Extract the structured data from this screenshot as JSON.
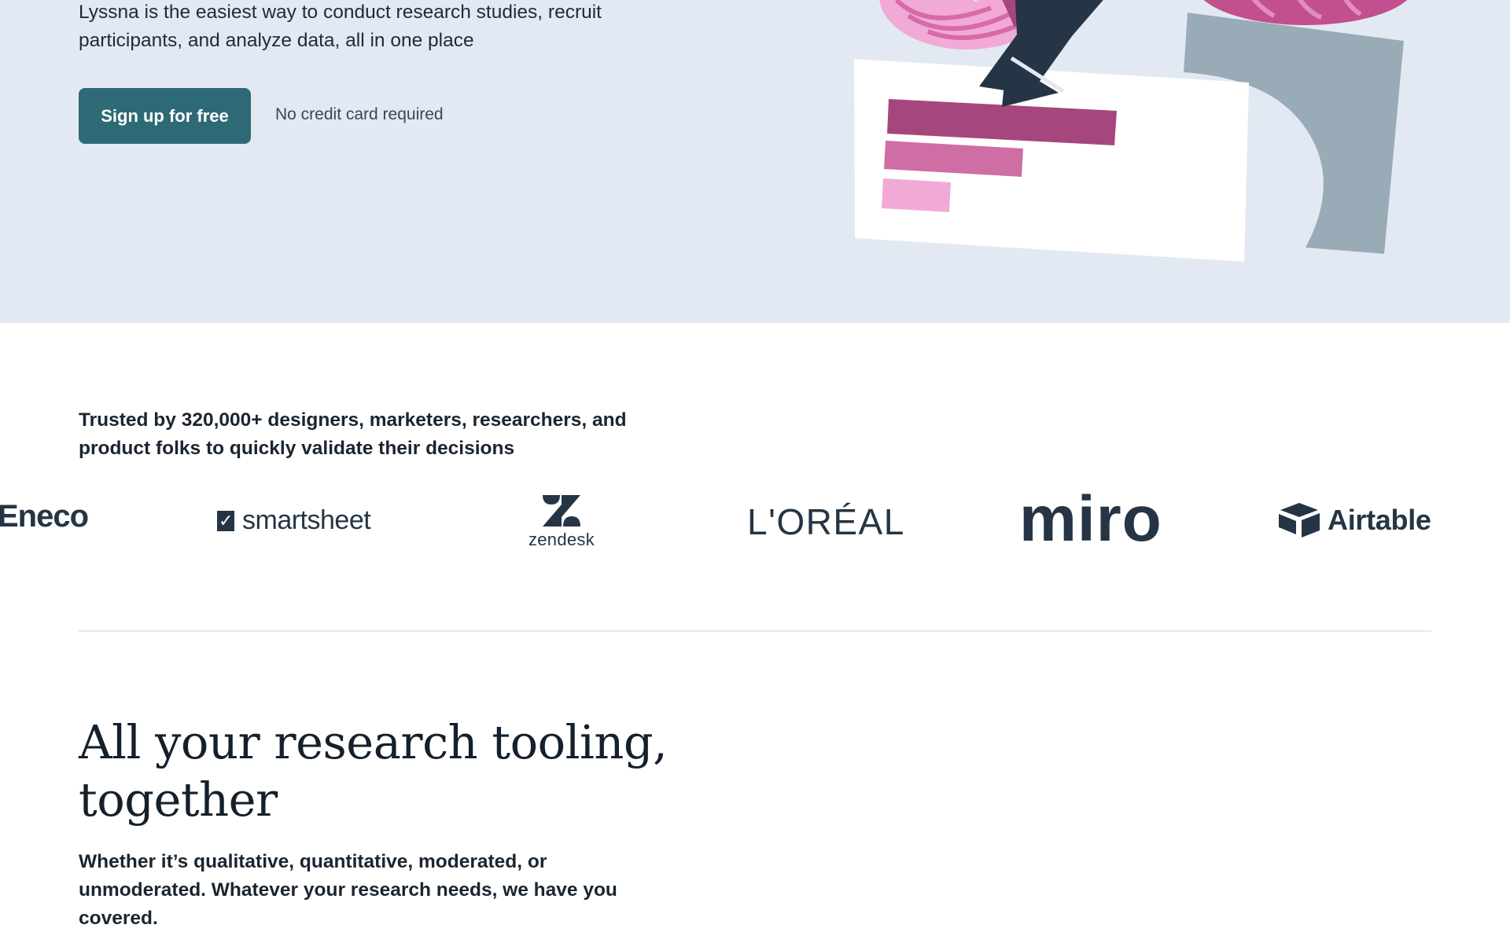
{
  "hero": {
    "description": "Lyssna is the easiest way to conduct research studies, recruit participants, and analyze data, all in one place",
    "cta_label": "Sign up for free",
    "cta_note": "No credit card required"
  },
  "trusted": {
    "text": "Trusted by 320,000+ designers, marketers, researchers, and product folks to quickly validate their decisions"
  },
  "logos": {
    "eneco": "Eneco",
    "smartsheet": "smartsheet",
    "zendesk": "zendesk",
    "loreal": "L'ORÉAL",
    "miro": "miro",
    "airtable": "Airtable"
  },
  "section": {
    "title": "All your research tooling, together",
    "description": "Whether it’s qualitative, quantitative, moderated, or unmoderated. Whatever your research needs, we have you covered."
  },
  "colors": {
    "hero_bg": "#e3e9f2",
    "cta_bg": "#2e6a76",
    "text_dark": "#1a2530",
    "pink_dark": "#a5477c",
    "pink_mid": "#cf6ea4",
    "pink_light": "#f1aad6",
    "navy": "#263546",
    "slate": "#9aabb8"
  }
}
